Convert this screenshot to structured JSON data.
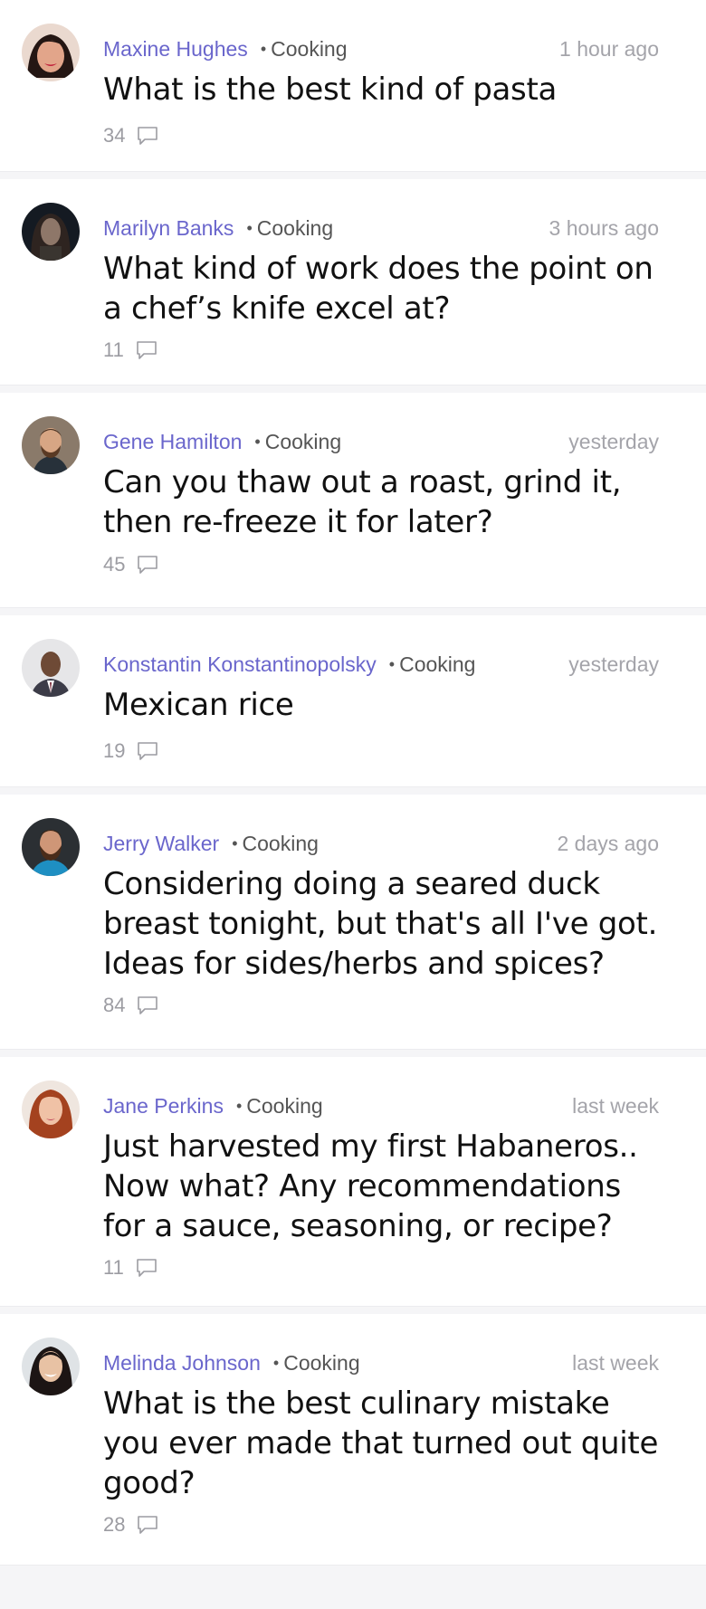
{
  "posts": [
    {
      "author": "Maxine Hughes",
      "category": "Cooking",
      "time": "1 hour ago",
      "title": "What is the best kind of pasta",
      "comments": "34",
      "avatar": "woman-red-lipstick-avatar"
    },
    {
      "author": "Marilyn Banks",
      "category": "Cooking",
      "time": "3 hours ago",
      "title": "What kind of work does the point on a chef’s knife excel at?",
      "comments": "11",
      "avatar": "dark-portrait-avatar"
    },
    {
      "author": "Gene Hamilton",
      "category": "Cooking",
      "time": "yesterday",
      "title": "Can you thaw out a roast, grind it, then re-freeze it for later?",
      "comments": "45",
      "avatar": "bearded-man-avatar"
    },
    {
      "author": "Konstantin Konstantinopolsky",
      "category": "Cooking",
      "time": "yesterday",
      "title": "Mexican rice",
      "comments": "19",
      "avatar": "man-suit-avatar"
    },
    {
      "author": "Jerry Walker",
      "category": "Cooking",
      "time": "2 days ago",
      "title": "Considering doing a seared duck breast tonight, but that's all I've got. Ideas for sides/herbs and spices?",
      "comments": "84",
      "avatar": "bearded-man-blue-shirt-avatar"
    },
    {
      "author": "Jane Perkins",
      "category": "Cooking",
      "time": "last week",
      "title": "Just harvested my first Habaneros.. Now what? Any recommendations for a sauce, seasoning, or recipe?",
      "comments": "11",
      "avatar": "red-haired-woman-avatar"
    },
    {
      "author": "Melinda Johnson",
      "category": "Cooking",
      "time": "last week",
      "title": "What is the best culinary mistake you ever made that turned out quite good?",
      "comments": "28",
      "avatar": "smiling-woman-avatar"
    }
  ],
  "colors": {
    "author": "#6a66cc",
    "meta": "#555555",
    "time": "#a4a4aa",
    "title": "#111111",
    "separator": "#f5f5f7"
  },
  "icons": {
    "separator": "bullet-dot",
    "comments": "speech-bubble-icon"
  }
}
